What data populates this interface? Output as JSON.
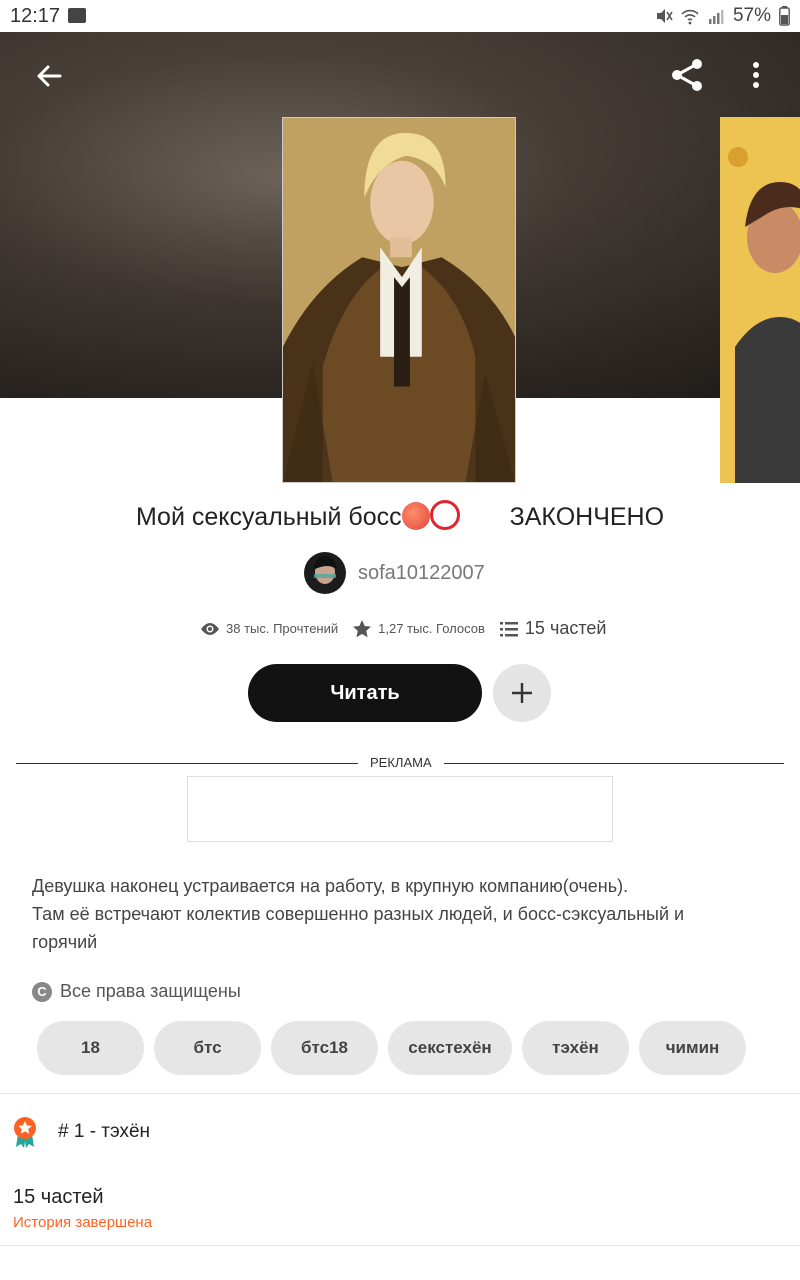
{
  "status_bar": {
    "time": "12:17",
    "battery": "57%"
  },
  "story": {
    "title": "Мой сексуальный босс",
    "status_label": "ЗАКОНЧЕНО",
    "author": "sofa10122007",
    "reads": "38 тыс. Прочтений",
    "votes": "1,27 тыс. Голосов",
    "parts": "15 частей",
    "read_button": "Читать",
    "ad_label": "РЕКЛАМА",
    "description": [
      "Девушка наконец устраивается на работу, в крупную компанию(очень).",
      "Там её встречают колектив совершенно разных людей, и босс-сэксуальный и",
      "горячий"
    ],
    "rights": "Все права защищены",
    "rights_icon": "C",
    "tags": [
      "18",
      "бтс",
      "бтс18",
      "секстехён",
      "тэхён",
      "чимин"
    ],
    "rank": "# 1 - тэхён",
    "parts_count": "15 частей",
    "completion": "История завершена"
  },
  "colors": {
    "accent": "#ff6122",
    "button": "#121212"
  },
  "icons": [
    "back-arrow-icon",
    "share-icon",
    "more-vertical-icon",
    "eye-icon",
    "star-icon",
    "list-icon",
    "plus-icon",
    "copyright-icon",
    "rank-badge-icon"
  ]
}
